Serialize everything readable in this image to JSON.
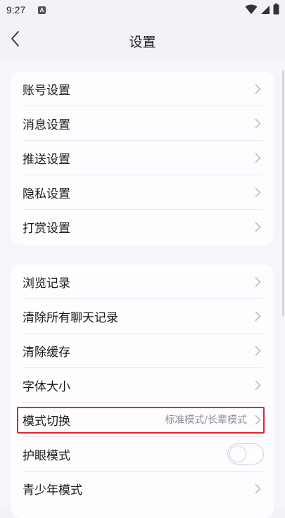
{
  "status_bar": {
    "time": "9:27",
    "app_icon_letter": "A",
    "icons": [
      "wifi-icon",
      "signal-icon",
      "battery-icon"
    ]
  },
  "header": {
    "title": "设置",
    "back_icon": "chevron-left-icon"
  },
  "group1": {
    "items": [
      {
        "label": "账号设置"
      },
      {
        "label": "消息设置"
      },
      {
        "label": "推送设置"
      },
      {
        "label": "隐私设置"
      },
      {
        "label": "打赏设置"
      }
    ]
  },
  "group2": {
    "items": [
      {
        "label": "浏览记录"
      },
      {
        "label": "清除所有聊天记录"
      },
      {
        "label": "清除缓存"
      },
      {
        "label": "字体大小"
      },
      {
        "label": "模式切换",
        "value": "标准模式/长辈模式"
      },
      {
        "label": "护眼模式",
        "toggle_on": false
      },
      {
        "label": "青少年模式"
      }
    ]
  },
  "colors": {
    "highlight": "#e0262e",
    "background": "#f4f2f6",
    "card": "#fefcff"
  }
}
